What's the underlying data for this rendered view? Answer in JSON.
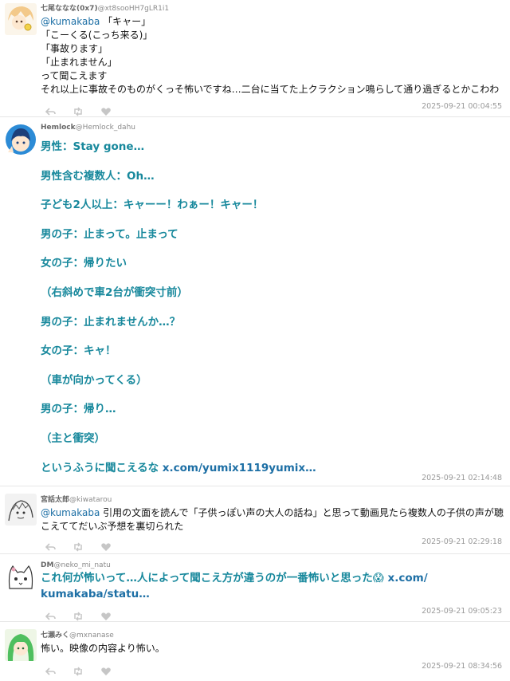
{
  "tweets": [
    {
      "name": "七尾ななな(0x7)",
      "handle": "@xt8sooHH7gLR1i1",
      "mention": "@kumakaba",
      "lines": [
        " 「キャー」",
        "「こーくる(こっち来る)」",
        "「事故ります」",
        "「止まれません」",
        "って聞こえます",
        "それ以上に事故そのものがくっそ怖いですね…二台に当てた上クラクション鳴らして通り過ぎるとかこわわ"
      ],
      "time": "2025-09-21 00:04:55"
    },
    {
      "name": "Hemlock",
      "handle": "@Hemlock_dahu",
      "lines": [
        "男性：Stay gone…",
        "男性含む複数人：Oh…",
        "子ども2人以上：キャーー！わぁー！キャー！",
        "男の子：止まって。止まって",
        "女の子：帰りたい",
        "（右斜めで車2台が衝突寸前）",
        "男の子：止まれませんか…？",
        "女の子：キャ！",
        "（車が向かってくる）",
        "男の子：帰り…",
        "（主と衝突）"
      ],
      "last_prefix": "というふうに聞こえるな ",
      "last_link": "x.com/yumix1119yumix…",
      "time": "2025-09-21 02:14:48"
    },
    {
      "name": "宮話太郎",
      "handle": "@kiwatarou",
      "mention": "@kumakaba",
      "lines": [
        " 引用の文面を読んで「子供っぽい声の大人の話ね」と思って動画見たら複数人の子供の声が聴",
        "こえててだいぶ予想を裏切られた"
      ],
      "time": "2025-09-21 02:29:18"
    },
    {
      "name": "DM",
      "handle": "@neko_mi_natu",
      "text": "これ何が怖いって…人によって聞こえ方が違うのが一番怖いと思った😱 ",
      "link1": "x.com/",
      "link2": "kumakaba/statu…",
      "time": "2025-09-21 09:05:23"
    },
    {
      "name": "七瀬みく",
      "handle": "@mxnanase",
      "lines": [
        "怖い。映像の内容より怖い。"
      ],
      "time": "2025-09-21 08:34:56"
    }
  ],
  "icons": [
    "reply-icon",
    "retweet-icon",
    "like-icon"
  ],
  "colors": {
    "accent_text": "#17889c",
    "link": "#1d6fa5",
    "meta": "#9a9a9a"
  }
}
